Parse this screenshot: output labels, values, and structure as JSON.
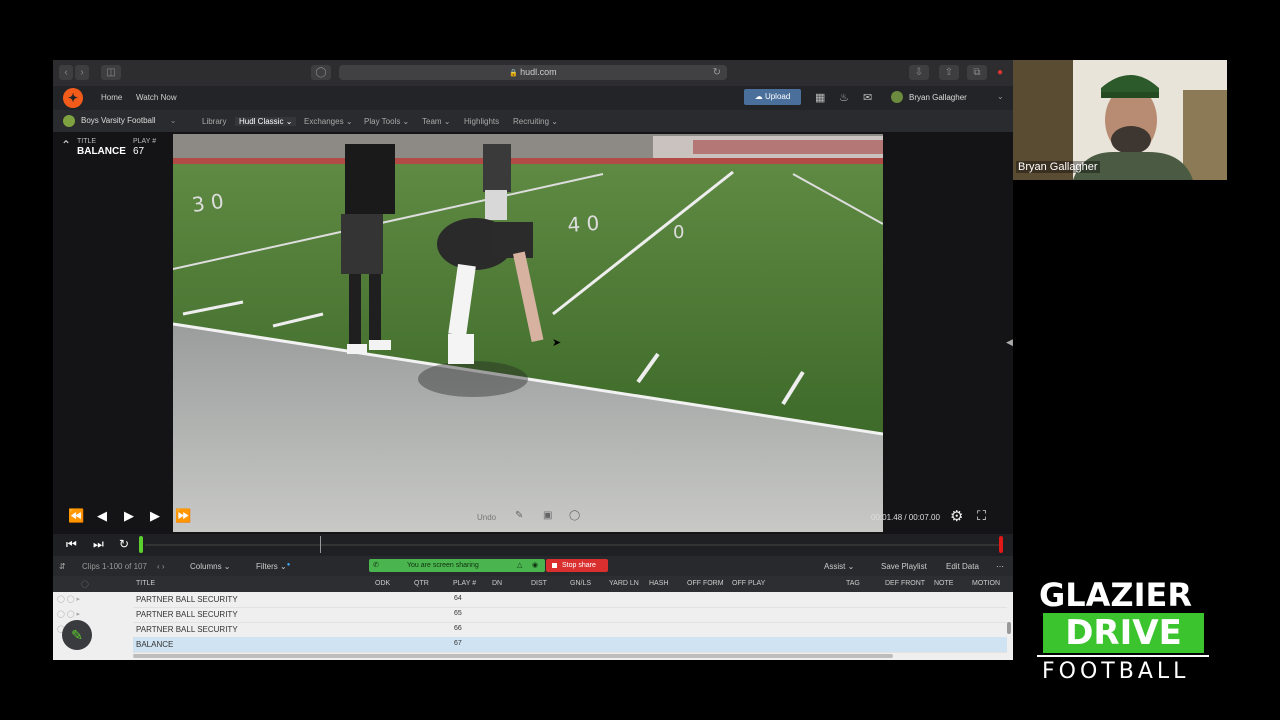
{
  "browser": {
    "url": "hudl.com"
  },
  "hudl_nav": {
    "top_links": [
      "Home",
      "Watch Now"
    ],
    "upload_label": "Upload",
    "user_name": "Bryan Gallagher",
    "team_name": "Boys Varsity Football",
    "sub_links": [
      "Library",
      "Hudl Classic",
      "Exchanges",
      "Play Tools",
      "Team",
      "Highlights",
      "Recruiting"
    ],
    "active_sub": "Hudl Classic"
  },
  "clip_info": {
    "title_label": "TITLE",
    "title_value": "BALANCE",
    "play_label": "PLAY #",
    "play_value": "67"
  },
  "controls": {
    "undo_label": "Undo",
    "timecode": "00:01.48 / 00:07.00"
  },
  "data_toolbar": {
    "clips_label": "Clips 1-100 of 107",
    "columns_label": "Columns",
    "filters_label": "Filters",
    "sharing_text": "You are screen sharing",
    "stop_share_label": "Stop share",
    "assist_label": "Assist",
    "save_playlist_label": "Save Playlist",
    "edit_data_label": "Edit Data"
  },
  "table": {
    "columns": [
      "TITLE",
      "ODK",
      "QTR",
      "PLAY #",
      "DN",
      "DIST",
      "GN/LS",
      "YARD LN",
      "HASH",
      "OFF FORM",
      "OFF PLAY",
      "TAG",
      "DEF FRONT",
      "NOTE",
      "MOTION"
    ],
    "rows": [
      {
        "title": "PARTNER BALL SECURITY",
        "play": "64"
      },
      {
        "title": "PARTNER BALL SECURITY",
        "play": "65"
      },
      {
        "title": "PARTNER BALL SECURITY",
        "play": "66"
      },
      {
        "title": "BALANCE",
        "play": "67"
      }
    ],
    "selected_row": 3
  },
  "webcam": {
    "participant_name": "Bryan Gallagher"
  },
  "logo": {
    "line1": "GLAZIER",
    "line2": "DRIVE",
    "line3": "FOOTBALL"
  },
  "colors": {
    "hudl_orange": "#f25b19",
    "accent_green": "#3cc42f",
    "stop_red": "#d9302f",
    "upload_blue": "#4a6f9b"
  }
}
